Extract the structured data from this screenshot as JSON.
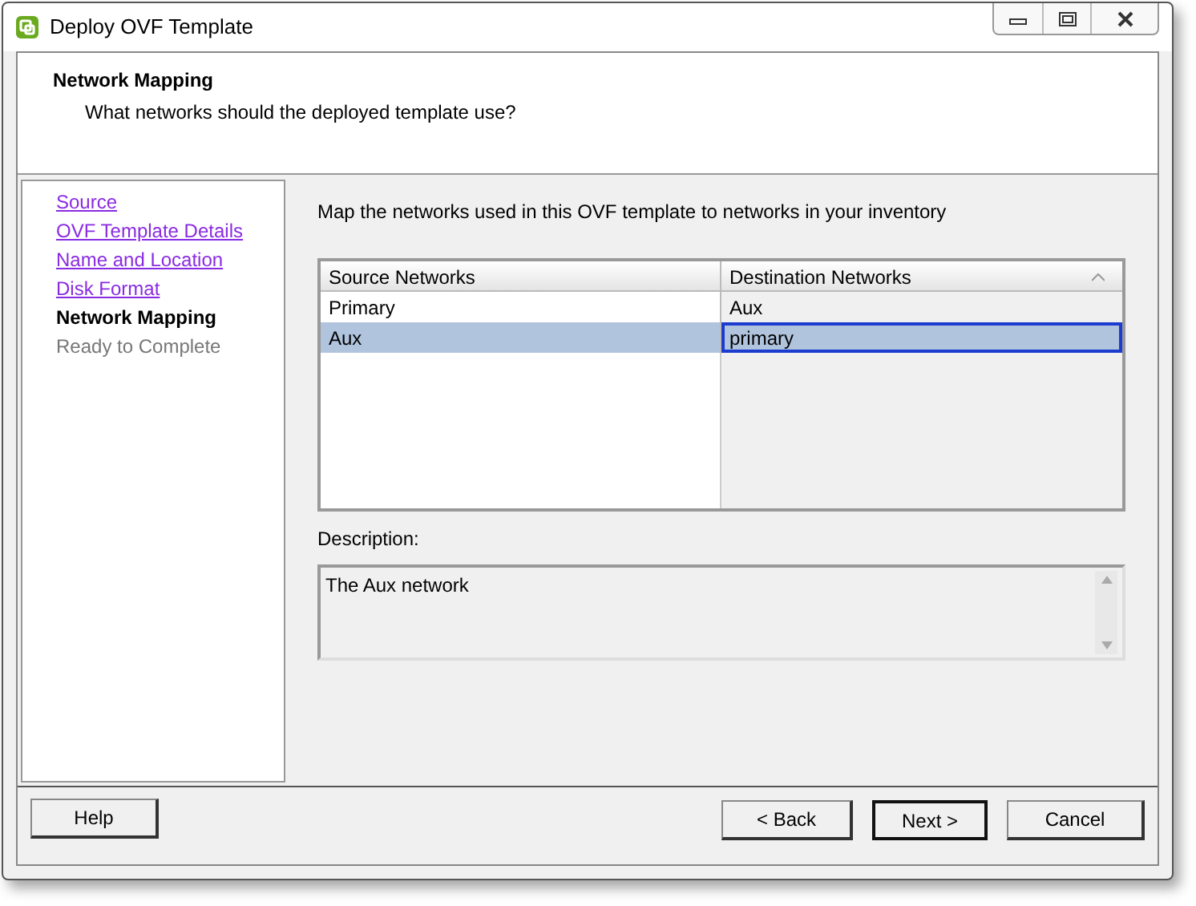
{
  "window": {
    "title": "Deploy OVF Template"
  },
  "header": {
    "title": "Network Mapping",
    "subtitle": "What networks should the deployed template use?"
  },
  "steps": [
    {
      "label": "Source",
      "kind": "link"
    },
    {
      "label": "OVF Template Details",
      "kind": "link"
    },
    {
      "label": "Name and Location",
      "kind": "link"
    },
    {
      "label": "Disk Format",
      "kind": "link"
    },
    {
      "label": "Network Mapping",
      "kind": "current"
    },
    {
      "label": "Ready to Complete",
      "kind": "pending"
    }
  ],
  "instruction": "Map the networks used in this OVF template to networks in your inventory",
  "table": {
    "columns": [
      "Source Networks",
      "Destination Networks"
    ],
    "rows": [
      {
        "cells": [
          "Primary",
          "Aux"
        ],
        "selected": false
      },
      {
        "cells": [
          "Aux",
          "primary"
        ],
        "selected": true
      }
    ]
  },
  "description": {
    "label": "Description:",
    "text": "The Aux network"
  },
  "buttons": [
    {
      "label": "Help",
      "default": false
    },
    {
      "label": "< Back",
      "default": false
    },
    {
      "label": "Next >",
      "default": true
    },
    {
      "label": "Cancel",
      "default": false
    }
  ]
}
